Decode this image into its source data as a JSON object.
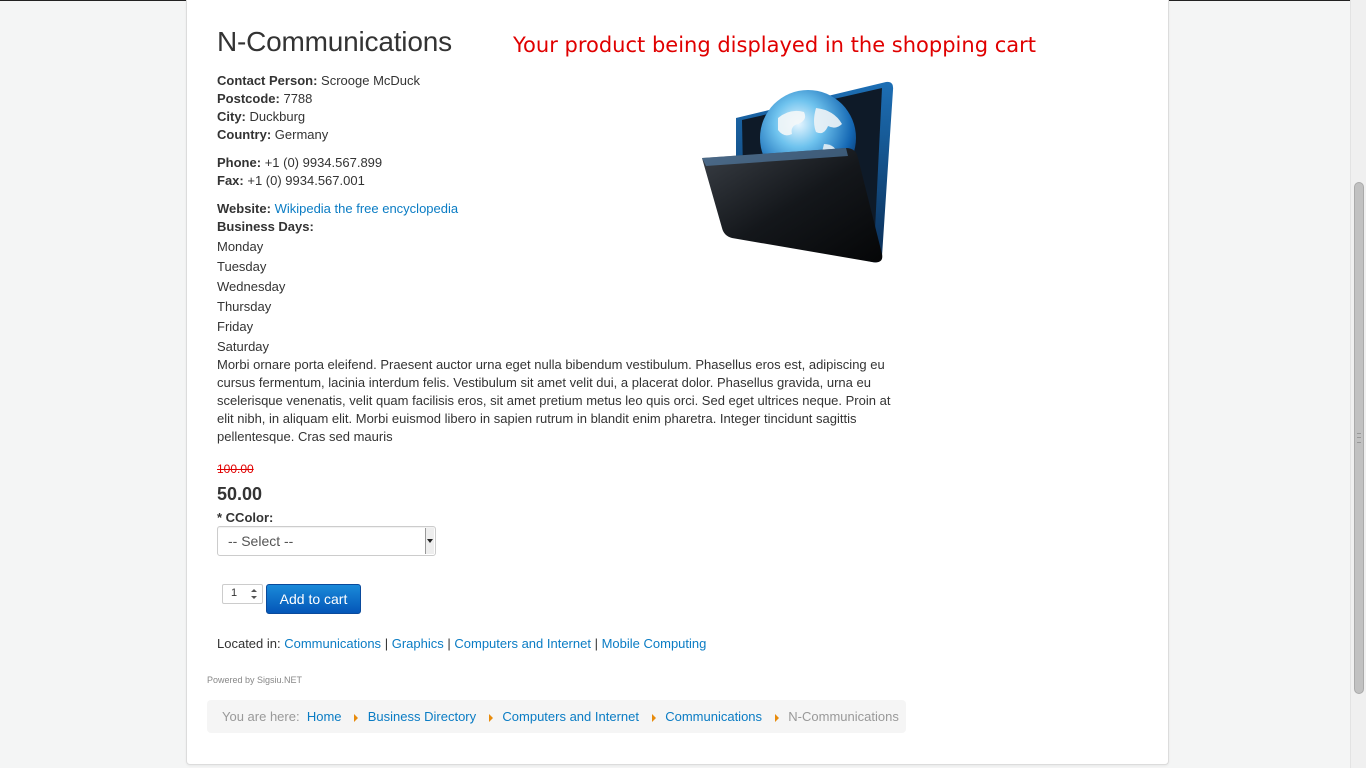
{
  "listing": {
    "title": "N-Communications",
    "overlay_caption": "Your product being displayed in the shopping cart",
    "contact_person_label": "Contact Person:",
    "contact_person": "Scrooge McDuck",
    "postcode_label": "Postcode:",
    "postcode": "7788",
    "city_label": "City:",
    "city": "Duckburg",
    "country_label": "Country:",
    "country": "Germany",
    "phone_label": "Phone:",
    "phone": "+1 (0) 9934.567.899",
    "fax_label": "Fax:",
    "fax": "+1 (0) 9934.567.001",
    "website_label": "Website:",
    "website_link": "Wikipedia the free encyclopedia",
    "business_days_label": "Business Days:",
    "business_days": [
      "Monday",
      "Tuesday",
      "Wednesday",
      "Thursday",
      "Friday",
      "Saturday"
    ],
    "description": "Morbi ornare porta eleifend. Praesent auctor urna eget nulla bibendum vestibulum. Phasellus eros est, adipiscing eu cursus fermentum, lacinia interdum felis. Vestibulum sit amet velit dui, a placerat dolor. Phasellus gravida, urna eu scelerisque venenatis, velit quam facilisis eros, sit amet pretium metus leo quis orci. Sed eget ultrices neque. Proin at elit nibh, in aliquam elit. Morbi euismod libero in sapien rutrum in blandit enim pharetra. Integer tincidunt sagittis pellentesque. Cras sed mauris",
    "product_image_icon": "globe-folder-icon"
  },
  "purchase": {
    "old_price": "100.00",
    "price": "50.00",
    "color_label": "* CColor:",
    "color_select_value": "-- Select --",
    "quantity": "1",
    "add_to_cart_label": "Add to cart"
  },
  "located": {
    "label": "Located in:",
    "categories": [
      "Communications",
      "Graphics",
      "Computers and Internet",
      "Mobile Computing"
    ],
    "separator": "|"
  },
  "footer": {
    "powered_by": "Powered by Sigsiu.NET"
  },
  "breadcrumb": {
    "prefix": "You are here:",
    "items": [
      "Home",
      "Business Directory",
      "Computers and Internet",
      "Communications"
    ],
    "current": "N-Communications"
  },
  "colors": {
    "link": "#0a7cc4",
    "overlay_text": "#e00000",
    "old_price": "#e00000",
    "button": "#0a6fcf",
    "breadcrumb_arrow": "#e88b0c"
  }
}
